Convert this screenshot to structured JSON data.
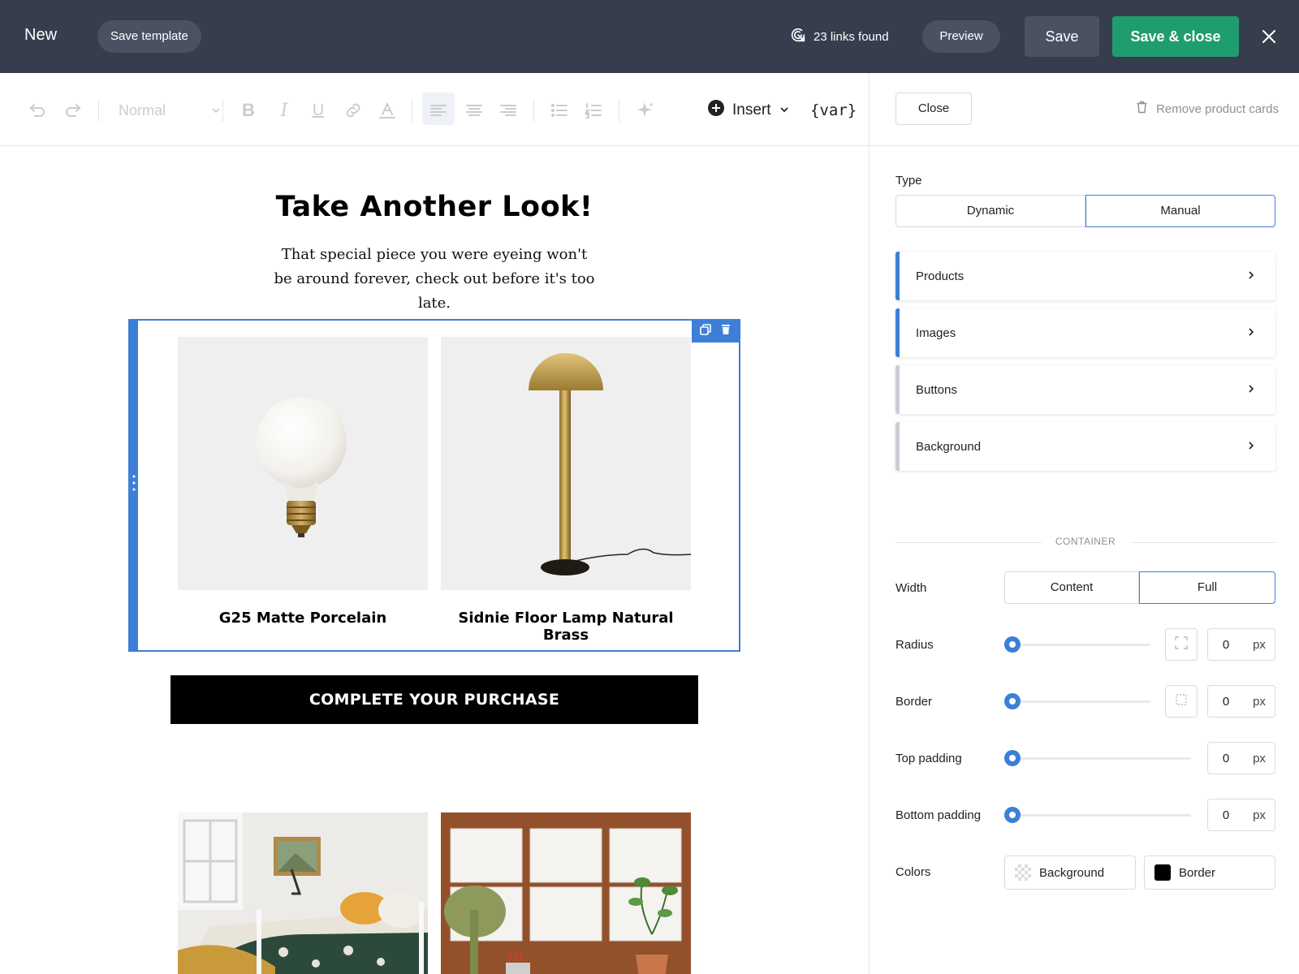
{
  "topbar": {
    "title": "New",
    "save_template": "Save template",
    "links_found": "23 links found",
    "preview": "Preview",
    "save": "Save",
    "save_close": "Save & close"
  },
  "toolbar": {
    "paragraph_style": "Normal",
    "insert": "Insert",
    "var": "{var}"
  },
  "email": {
    "title": "Take Another Look!",
    "subtitle": "That special piece you were eyeing won't be around forever, check out before it's too late.",
    "products": [
      {
        "name": "G25 Matte Porcelain"
      },
      {
        "name": "Sidnie Floor Lamp Natural Brass"
      }
    ],
    "cta": "COMPLETE YOUR PURCHASE"
  },
  "panel": {
    "close": "Close",
    "remove_cards": "Remove product cards",
    "type_label": "Type",
    "type_options": [
      "Dynamic",
      "Manual"
    ],
    "type_selected": "Manual",
    "sections": [
      "Products",
      "Images",
      "Buttons",
      "Background"
    ],
    "container_heading": "CONTAINER",
    "width_label": "Width",
    "width_options": [
      "Content",
      "Full"
    ],
    "width_selected": "Full",
    "radius": {
      "label": "Radius",
      "value": "0",
      "unit": "px"
    },
    "border": {
      "label": "Border",
      "value": "0",
      "unit": "px"
    },
    "top_padding": {
      "label": "Top padding",
      "value": "0",
      "unit": "px"
    },
    "bottom_padding": {
      "label": "Bottom padding",
      "value": "0",
      "unit": "px"
    },
    "colors_label": "Colors",
    "color_background": {
      "label": "Background",
      "swatch": "transparent"
    },
    "color_border": {
      "label": "Border",
      "swatch": "#000000"
    }
  },
  "theme": {
    "topbar_bg": "#363e4d",
    "accent": "#3d7fd6",
    "primary_green": "#1f9d6f"
  }
}
